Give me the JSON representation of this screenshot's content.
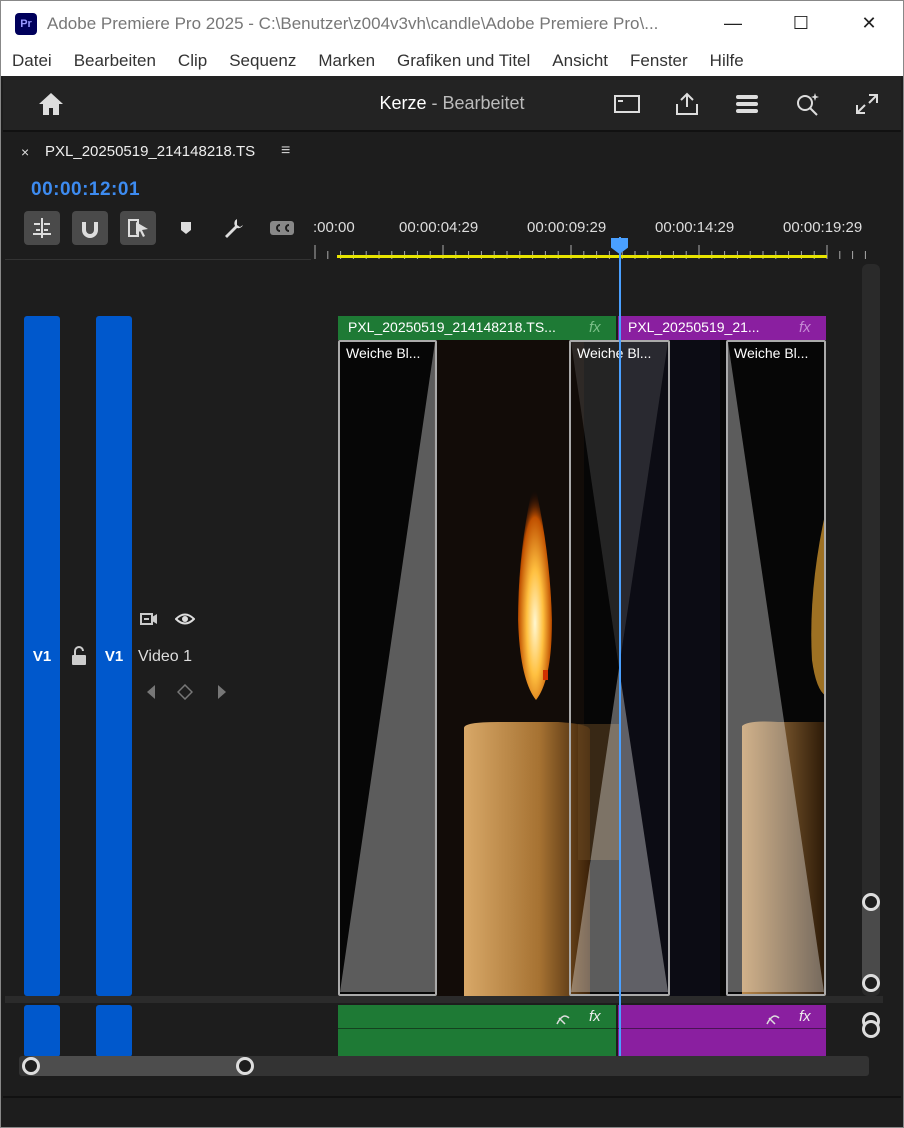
{
  "window": {
    "title": "Adobe Premiere Pro 2025 - C:\\Benutzer\\z004v3vh\\candle\\Adobe Premiere Pro\\...",
    "app_badge": "Pr",
    "buttons": {
      "minimize": "—",
      "maximize": "☐",
      "close": "✕"
    }
  },
  "menubar": [
    "Datei",
    "Bearbeiten",
    "Clip",
    "Sequenz",
    "Marken",
    "Grafiken und Titel",
    "Ansicht",
    "Fenster",
    "Hilfe"
  ],
  "header": {
    "project": "Kerze",
    "separator": " - ",
    "status": "Bearbeitet"
  },
  "panel": {
    "tab_close": "×",
    "tab_name": "PXL_20250519_214148218.TS",
    "tab_menu": "≡",
    "timecode": "00:00:12:01"
  },
  "ruler": {
    "labels": [
      ":00:00",
      "00:00:04:29",
      "00:00:09:29",
      "00:00:14:29",
      "00:00:19:29"
    ]
  },
  "tracks": {
    "video": {
      "source": "V1",
      "target": "V1",
      "name": "Video 1"
    },
    "audio": {
      "source": "",
      "target": ""
    }
  },
  "clips": {
    "clip1": {
      "name": "PXL_20250519_214148218.TS...",
      "fx": "fx",
      "color": "#1e7a35"
    },
    "clip2": {
      "name": "PXL_20250519_21...",
      "fx": "fx",
      "color": "#8a1fa0"
    }
  },
  "transitions": [
    "Weiche Bl...",
    "Weiche Bl...",
    "Weiche Bl..."
  ],
  "audio_fx": {
    "fx1": "fx",
    "fx2": "fx"
  },
  "colors": {
    "accent": "#3d8bf0",
    "track": "#0058cc",
    "clip_green": "#1e7a35",
    "clip_purple": "#8a1fa0",
    "work_area": "#e8e400"
  }
}
